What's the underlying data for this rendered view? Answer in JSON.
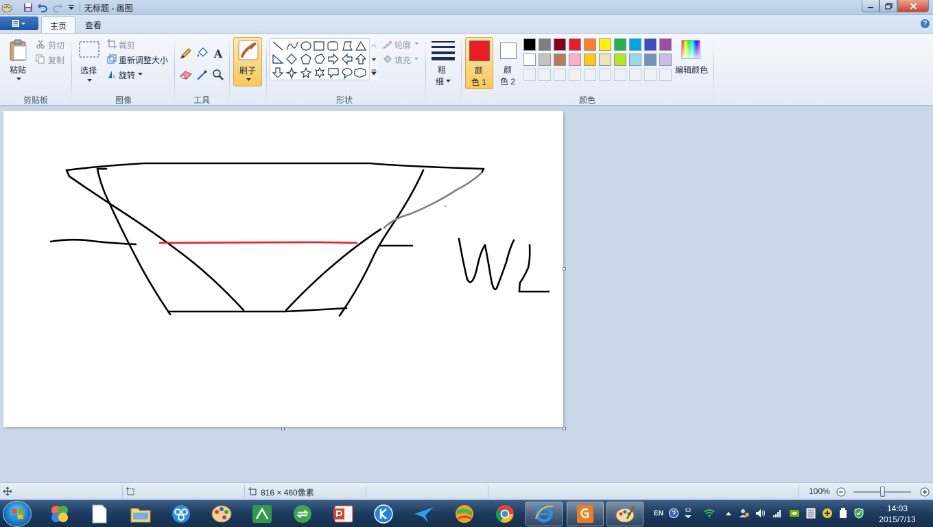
{
  "window": {
    "title": "无标题 - 画图"
  },
  "tabs": {
    "home": "主页",
    "view": "查看"
  },
  "ribbon": {
    "clipboard": {
      "label": "剪贴板",
      "paste": "粘贴",
      "cut": "剪切",
      "copy": "复制"
    },
    "image": {
      "label": "图像",
      "select": "选择",
      "crop": "裁剪",
      "resize": "重新调整大小",
      "rotate": "旋转"
    },
    "tools": {
      "label": "工具"
    },
    "brushes": {
      "label": "刷子"
    },
    "shapes": {
      "label": "形状",
      "outline": "轮廓",
      "fill": "填充"
    },
    "size": {
      "label_line1": "粗",
      "label_line2": "细"
    },
    "colors": {
      "label": "颜色",
      "color1_line1": "颜",
      "color1_line2": "色 1",
      "color2_line1": "颜",
      "color2_line2": "色 2",
      "edit": "编辑颜色",
      "color1_value": "#ed1c24",
      "color2_value": "#ffffff",
      "palette_row1": [
        "#000000",
        "#7f7f7f",
        "#880015",
        "#ed1c24",
        "#ff7f27",
        "#fff200",
        "#22b14c",
        "#00a2e8",
        "#3f48cc",
        "#a349a4"
      ],
      "palette_row2": [
        "#ffffff",
        "#c3c3c3",
        "#b97a57",
        "#ffaec9",
        "#ffc90e",
        "#efe4b0",
        "#b5e61d",
        "#99d9ea",
        "#7092be",
        "#c8bfe7"
      ]
    }
  },
  "canvas": {
    "drawn_text": "WL"
  },
  "statusbar": {
    "size": "816 × 460像素",
    "zoom": "100%"
  },
  "taskbar": {
    "lang": "EN",
    "time": "14:03",
    "date": "2015/7/13"
  }
}
